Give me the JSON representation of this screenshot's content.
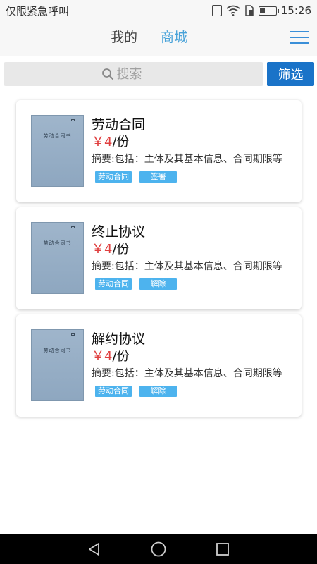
{
  "status_bar": {
    "carrier": "仅限紧急呼叫",
    "time": "15:26",
    "battery_level": 0.35,
    "icons": [
      "vibrate-icon",
      "wifi-icon",
      "sim-icon",
      "battery-icon"
    ]
  },
  "header": {
    "tabs": [
      {
        "label": "我的",
        "active": false
      },
      {
        "label": "商城",
        "active": true
      }
    ],
    "menu_icon": "hamburger-menu-icon"
  },
  "search": {
    "placeholder": "搜索",
    "filter_label": "筛选"
  },
  "colors": {
    "accent": "#1a73c8",
    "active_tab": "#4aa3d9",
    "price": "#e04040",
    "tag": "#4db3ee"
  },
  "products": [
    {
      "title": "劳动合同",
      "price_symbol": "￥",
      "price": "4",
      "unit": "/份",
      "summary": "摘要:包括：主体及其基本信息、合同期限等",
      "tags": [
        "劳动合同",
        "签署"
      ],
      "thumb_title": "劳动合同书"
    },
    {
      "title": "终止协议",
      "price_symbol": "￥",
      "price": "4",
      "unit": "/份",
      "summary": "摘要:包括：主体及其基本信息、合同期限等",
      "tags": [
        "劳动合同",
        "解除"
      ],
      "thumb_title": "劳动合同书"
    },
    {
      "title": "解约协议",
      "price_symbol": "￥",
      "price": "4",
      "unit": "/份",
      "summary": "摘要:包括：主体及其基本信息、合同期限等",
      "tags": [
        "劳动合同",
        "解除"
      ],
      "thumb_title": "劳动合同书"
    }
  ],
  "nav_bar": {
    "icons": [
      "back-icon",
      "home-icon",
      "recent-apps-icon"
    ]
  }
}
